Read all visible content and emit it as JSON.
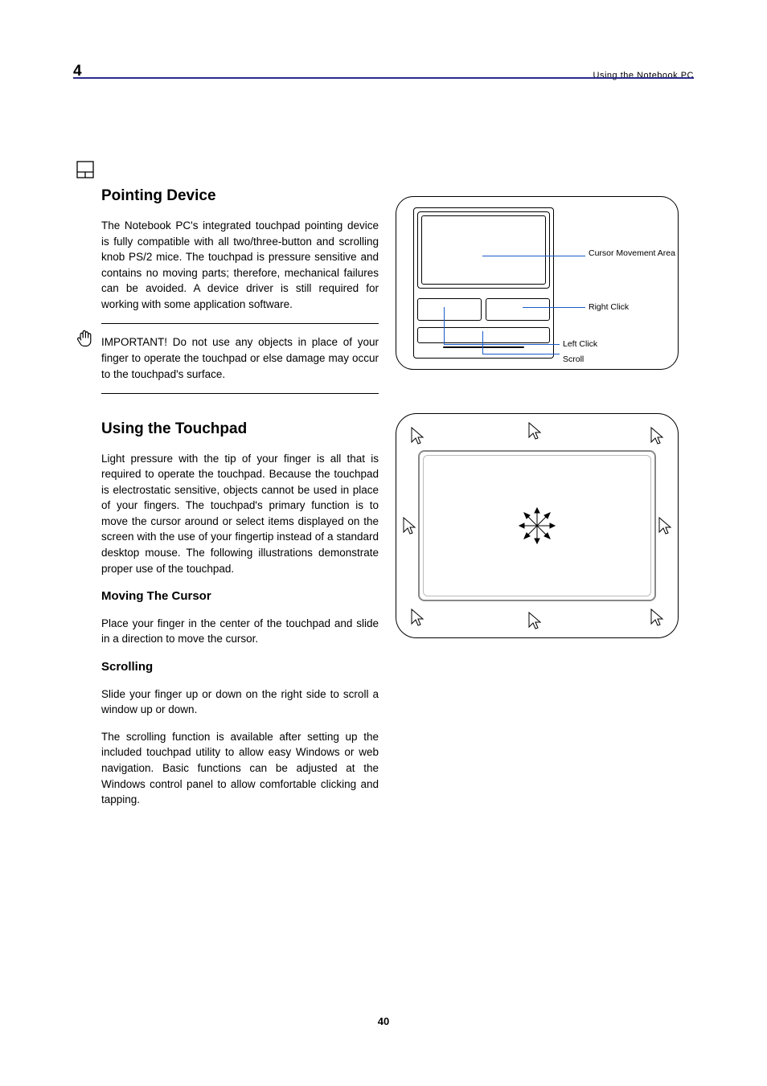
{
  "header": {
    "chapter_num": "4",
    "chapter_title": "Using the Notebook PC"
  },
  "page_number": "40",
  "section": {
    "title": "Pointing Device",
    "para1": "The Notebook PC's integrated touchpad pointing device is fully compatible with all two/three-button and scrolling knob PS/2 mice. The touchpad is pressure sensitive and contains no moving parts; therefore, mechanical failures can be avoided. A device driver is still required for working with some application software.",
    "caution": "IMPORTANT! Do not use any objects in place of your finger to operate the touchpad or else damage may occur to the touchpad's surface."
  },
  "figure_labels": {
    "cursor_area": "Cursor Movement Area",
    "right_click": "Right Click",
    "left_click": "Left Click",
    "scroll": "Scroll"
  },
  "using_section": {
    "title": "Using the Touchpad",
    "para1": "Light pressure with the tip of your finger is all that is required to operate the touchpad. Because the touchpad is electrostatic sensitive, objects cannot be used in place of your fingers. The touchpad's primary function is to move the cursor around or select items displayed on the screen with the use of your fingertip instead of a standard desktop mouse. The following illustrations demonstrate proper use of the touchpad.",
    "sub1_title": "Moving The Cursor",
    "sub1_body": "Place your finger in the center of the touchpad and slide in a direction to move the cursor.",
    "sub2_title": "Scrolling",
    "sub2_body": "Slide your finger up or down on the right side to scroll a window up or down.",
    "footnote": "The scrolling function is available after setting up the included touchpad utility to allow easy Windows or web navigation. Basic functions can be adjusted at the Windows control panel to allow comfortable clicking and tapping."
  }
}
